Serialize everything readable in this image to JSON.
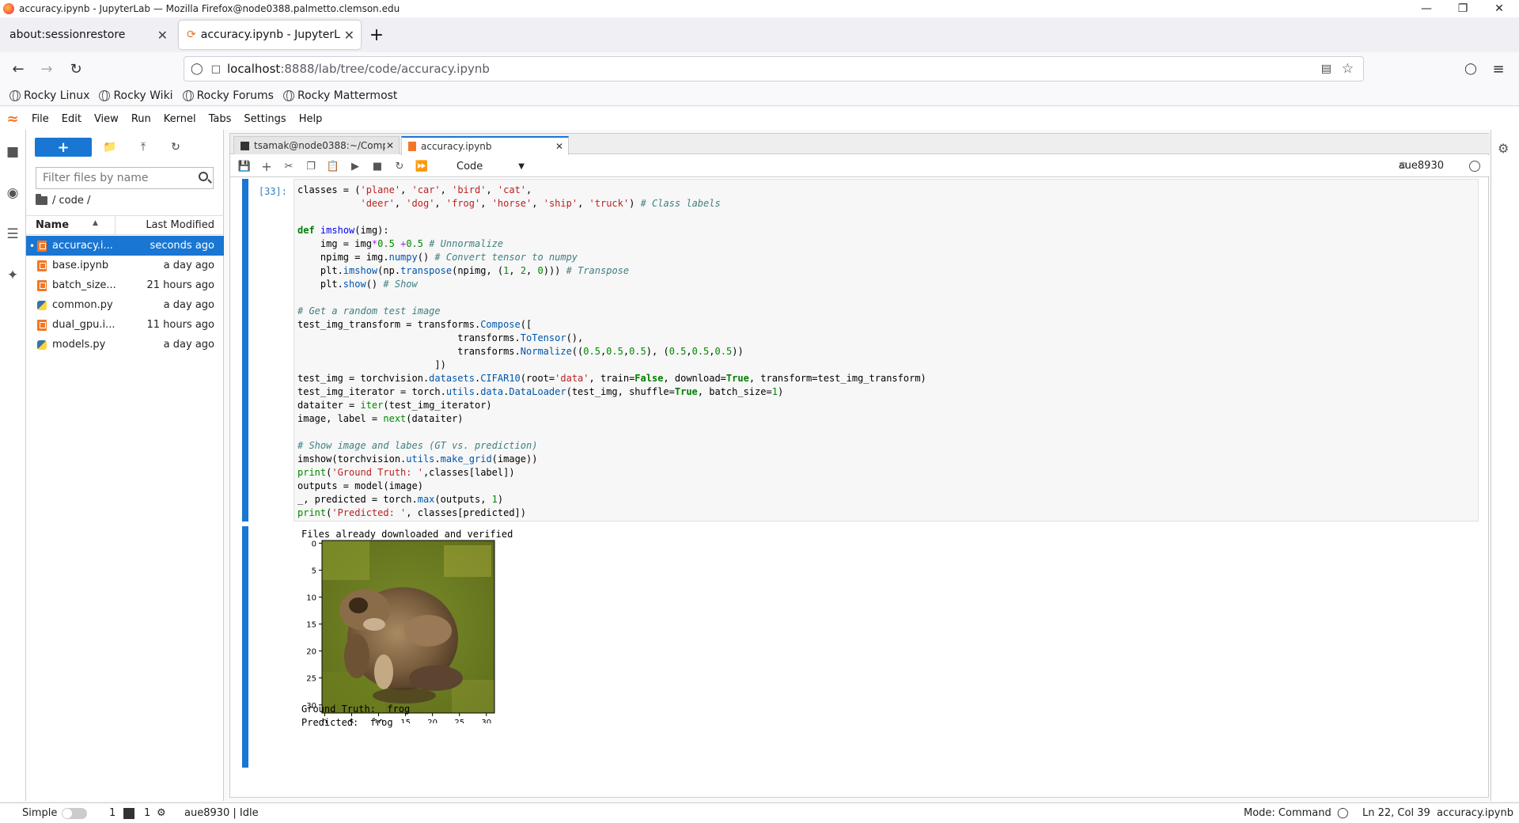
{
  "window": {
    "title": "accuracy.ipynb - JupyterLab — Mozilla Firefox@node0388.palmetto.clemson.edu"
  },
  "browser_tabs": [
    {
      "label": "about:sessionrestore"
    },
    {
      "label": "accuracy.ipynb - JupyterL"
    }
  ],
  "url": {
    "host": "localhost",
    "rest": ":8888/lab/tree/code/accuracy.ipynb"
  },
  "bookmarks": [
    "Rocky Linux",
    "Rocky Wiki",
    "Rocky Forums",
    "Rocky Mattermost"
  ],
  "menu": [
    "File",
    "Edit",
    "View",
    "Run",
    "Kernel",
    "Tabs",
    "Settings",
    "Help"
  ],
  "filebrowser": {
    "filter_placeholder": "Filter files by name",
    "path": "/ code /",
    "col_name": "Name",
    "col_modified": "Last Modified",
    "files": [
      {
        "name": "accuracy.i...",
        "modified": "seconds ago",
        "type": "notebook",
        "selected": true
      },
      {
        "name": "base.ipynb",
        "modified": "a day ago",
        "type": "notebook"
      },
      {
        "name": "batch_size...",
        "modified": "21 hours ago",
        "type": "notebook"
      },
      {
        "name": "common.py",
        "modified": "a day ago",
        "type": "python"
      },
      {
        "name": "dual_gpu.i...",
        "modified": "11 hours ago",
        "type": "notebook"
      },
      {
        "name": "models.py",
        "modified": "a day ago",
        "type": "python"
      }
    ]
  },
  "doc_tabs": [
    {
      "label": "tsamak@node0388:~/Comp"
    },
    {
      "label": "accuracy.ipynb"
    }
  ],
  "notebook": {
    "cell_type": "Code",
    "kernel_name": "aue8930",
    "prompt": "[33]:",
    "output_line1": "Files already downloaded and verified",
    "output_gt": "Ground Truth:  frog",
    "output_pred": "Predicted:  frog"
  },
  "plot": {
    "yticks": [
      "0",
      "5",
      "10",
      "15",
      "20",
      "25",
      "30"
    ],
    "xticks": [
      "0",
      "5",
      "10",
      "15",
      "20",
      "25",
      "30"
    ]
  },
  "status": {
    "mode_label": "Simple",
    "count1": "1",
    "count2": "1",
    "kernel_status": "aue8930 | Idle",
    "mode": "Mode: Command",
    "position": "Ln 22, Col 39",
    "filename": "accuracy.ipynb"
  }
}
